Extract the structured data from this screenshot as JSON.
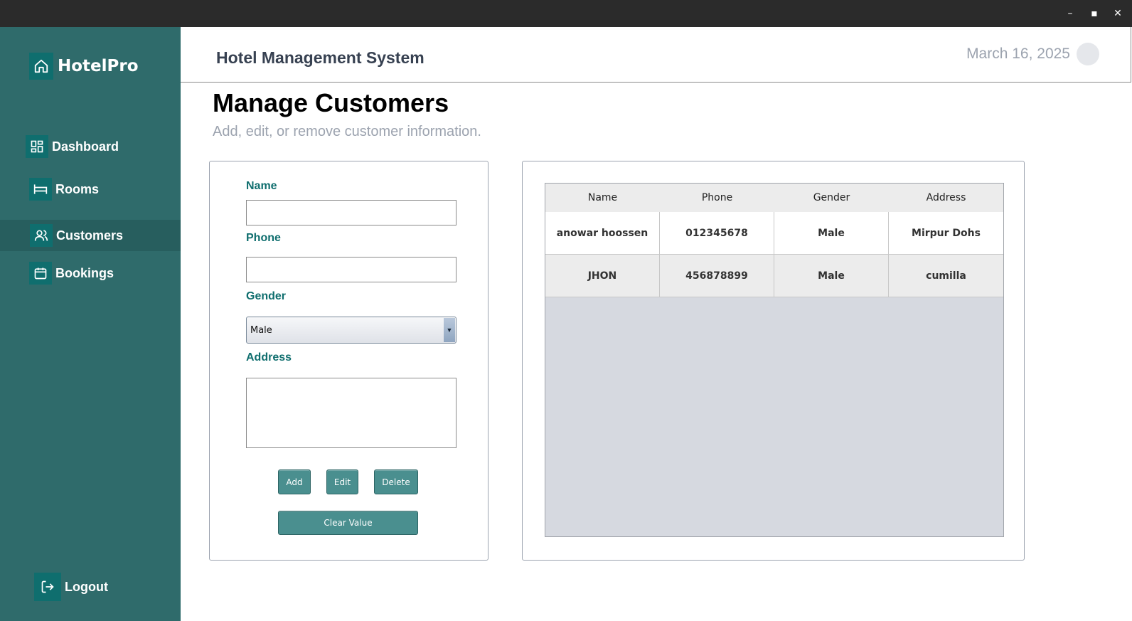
{
  "window": {
    "min_glyph": "–",
    "max_glyph": "▪",
    "close_glyph": "✕"
  },
  "sidebar": {
    "brand": "HotelPro",
    "items": [
      {
        "label": "Dashboard",
        "icon": "grid-icon"
      },
      {
        "label": "Rooms",
        "icon": "bed-icon"
      },
      {
        "label": "Customers",
        "icon": "users-icon",
        "active": true
      },
      {
        "label": "Bookings",
        "icon": "calendar-icon"
      }
    ],
    "logout": "Logout"
  },
  "header": {
    "title": "Hotel Management System",
    "date": "March 16, 2025"
  },
  "page": {
    "title": "Manage Customers",
    "subtitle": "Add, edit, or remove customer information."
  },
  "form": {
    "name_label": "Name",
    "name_value": "",
    "phone_label": "Phone",
    "phone_value": "",
    "gender_label": "Gender",
    "gender_value": "Male",
    "address_label": "Address",
    "address_value": "",
    "add_label": "Add",
    "edit_label": "Edit",
    "delete_label": "Delete",
    "clear_label": "Clear Value"
  },
  "table": {
    "columns": [
      "Name",
      "Phone",
      "Gender",
      "Address"
    ],
    "rows": [
      [
        "anowar hoossen",
        "012345678",
        "Male",
        "Mirpur Dohs"
      ],
      [
        "JHON",
        "456878899",
        "Male",
        "cumilla"
      ]
    ]
  },
  "colors": {
    "sidebar_bg": "#2f6b6b",
    "accent": "#0f6e6e",
    "button": "#4a8f8f"
  }
}
